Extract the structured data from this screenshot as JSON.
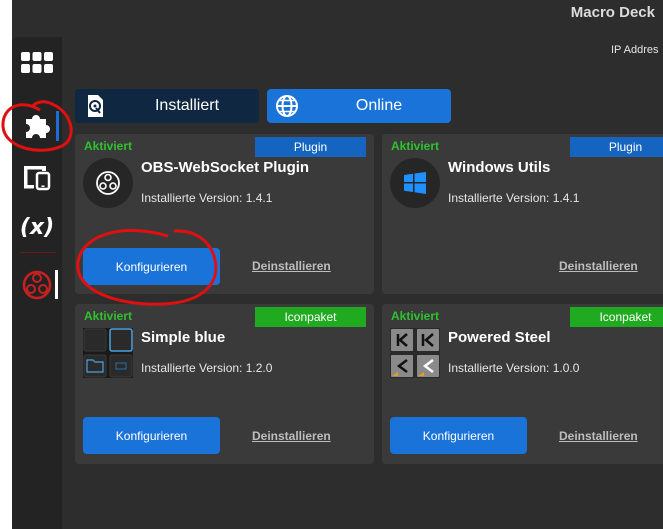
{
  "app": {
    "title": "Macro Deck",
    "ip_label": "IP Addres"
  },
  "sidebar": {
    "items": [
      {
        "name": "grid-icon"
      },
      {
        "name": "puzzle-icon"
      },
      {
        "name": "devices-icon"
      },
      {
        "name": "variables",
        "label": "(x)"
      },
      {
        "name": "obs-icon"
      }
    ]
  },
  "tabs": [
    {
      "label": "Installiert",
      "icon": "sd-card-icon"
    },
    {
      "label": "Online",
      "icon": "globe-icon"
    }
  ],
  "cards": [
    {
      "status": "Aktiviert",
      "badge": "Plugin",
      "name": "OBS-WebSocket Plugin",
      "version": "Installierte Version: 1.4.1",
      "configure": "Konfigurieren",
      "uninstall": "Deinstallieren"
    },
    {
      "status": "Aktiviert",
      "badge": "Plugin",
      "name": "Windows Utils",
      "version": "Installierte Version: 1.4.1",
      "uninstall": "Deinstallieren"
    },
    {
      "status": "Aktiviert",
      "badge": "Iconpaket",
      "name": "Simple blue",
      "version": "Installierte Version: 1.2.0",
      "configure": "Konfigurieren",
      "uninstall": "Deinstallieren"
    },
    {
      "status": "Aktiviert",
      "badge": "Iconpaket",
      "name": "Powered Steel",
      "version": "Installierte Version: 1.0.0",
      "configure": "Konfigurieren",
      "uninstall": "Deinstallieren"
    }
  ],
  "colors": {
    "accent": "#1a73d9",
    "status_green": "#2ec22e",
    "badge_plugin": "#1565c0",
    "badge_iconpack": "#1faa1f",
    "annotation": "#e01010"
  }
}
